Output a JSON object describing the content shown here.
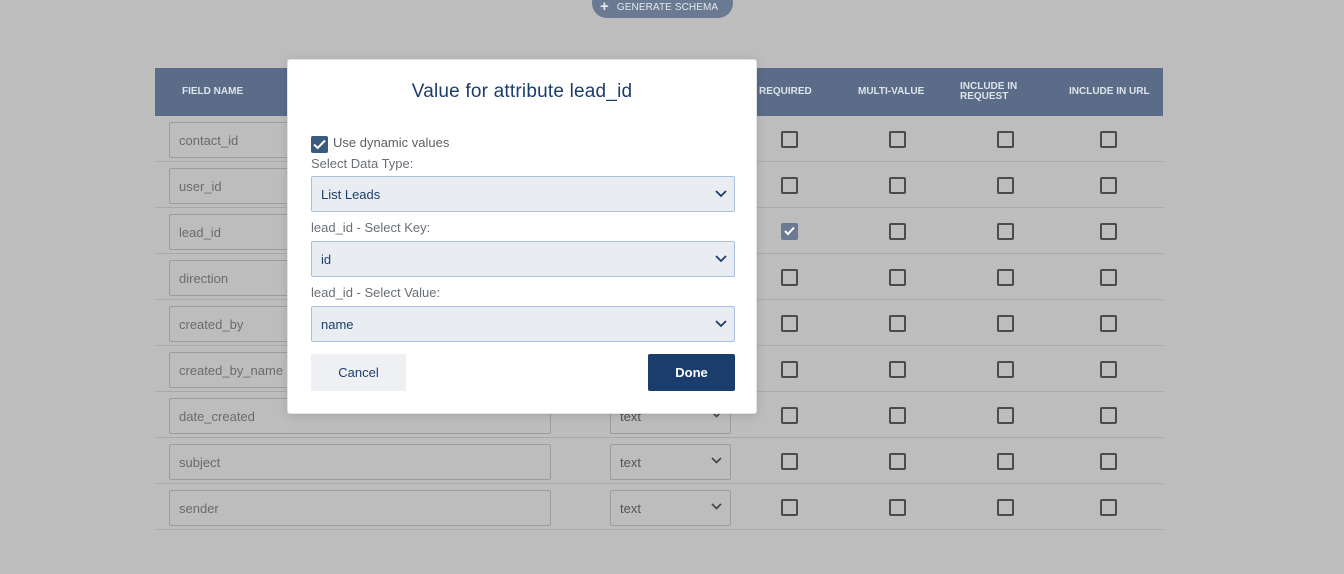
{
  "toolbar": {
    "generate_label": "GENERATE SCHEMA"
  },
  "table": {
    "headers": {
      "field_name": "FIELD NAME",
      "required": "REQUIRED",
      "multi_value": "MULTI-VALUE",
      "include_in_request": "INCLUDE IN REQUEST",
      "include_in_url": "INCLUDE IN URL"
    },
    "rows": [
      {
        "field": "contact_id",
        "type": "",
        "required": false
      },
      {
        "field": "user_id",
        "type": "",
        "required": false
      },
      {
        "field": "lead_id",
        "type": "",
        "required": true
      },
      {
        "field": "direction",
        "type": "",
        "required": false
      },
      {
        "field": "created_by",
        "type": "",
        "required": false
      },
      {
        "field": "created_by_name",
        "type": "",
        "required": false
      },
      {
        "field": "date_created",
        "type": "text",
        "required": false
      },
      {
        "field": "subject",
        "type": "text",
        "required": false
      },
      {
        "field": "sender",
        "type": "text",
        "required": false
      }
    ]
  },
  "modal": {
    "title": "Value for attribute lead_id",
    "dynamic_label": "Use dynamic values",
    "dynamic_checked": true,
    "data_type_label": "Select Data Type:",
    "data_type_value": "List Leads",
    "key_label": "lead_id - Select Key:",
    "key_value": "id",
    "value_label": "lead_id - Select Value:",
    "value_value": "name",
    "cancel_label": "Cancel",
    "done_label": "Done"
  },
  "colors": {
    "overlay_bg": "#bdbdbd",
    "header_bg": "#5a6c87",
    "primary": "#1b3d6c",
    "select_bg": "#e9edf2"
  }
}
